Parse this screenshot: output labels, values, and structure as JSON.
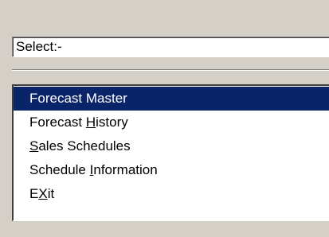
{
  "select": {
    "label": "Select:-"
  },
  "menu": {
    "items": [
      {
        "pre": "Forecast Master",
        "key": "",
        "post": "",
        "selected": true
      },
      {
        "pre": "Forecast ",
        "key": "H",
        "post": "istory",
        "selected": false
      },
      {
        "pre": "",
        "key": "S",
        "post": "ales Schedules",
        "selected": false
      },
      {
        "pre": "Schedule ",
        "key": "I",
        "post": "nformation",
        "selected": false
      },
      {
        "pre": "E",
        "key": "X",
        "post": "it",
        "selected": false
      }
    ]
  },
  "colors": {
    "window_bg": "#d4d0c8",
    "selection_bg": "#0a246a",
    "selection_text": "#ffffff",
    "list_bg": "#ffffff"
  }
}
